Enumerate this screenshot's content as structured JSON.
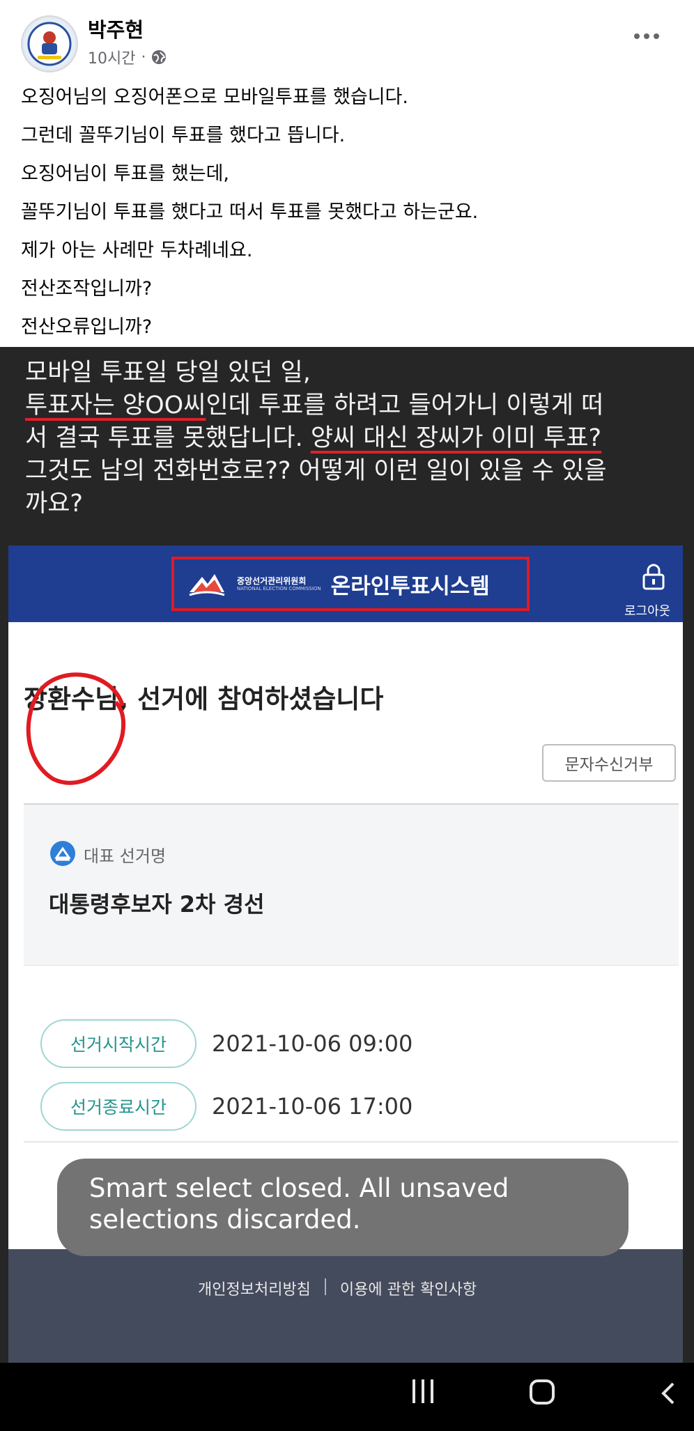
{
  "post": {
    "author": "박주현",
    "time": "10시간",
    "separator": "·",
    "lines": [
      "오징어님의 오징어폰으로 모바일투표를 했습니다.",
      "그런데 꼴뚜기님이 투표를 했다고 뜹니다.",
      "오징어님이 투표를 했는데,",
      "꼴뚜기님이 투표를 했다고 떠서 투표를 못했다고 하는군요.",
      "제가 아는 사례만 두차례네요.",
      "전산조작입니까?",
      "전산오류입니까?"
    ]
  },
  "image": {
    "caption": {
      "line1": "모바일 투표일 당일 있던 일,",
      "line2_underlined": "투표자는 양OO씨",
      "line2_rest": "인데 투표를 하려고 들어가니 이렇게 떠",
      "line3_prefix": "서 결국 투표를 못했답니다. ",
      "line3_underlined": "양씨 대신 장씨가 이미 투표?",
      "line4": "그것도 남의 전화번호로?? 어떻게 이런 일이 있을 수 있을",
      "line5": "까요?"
    },
    "app": {
      "org_name": "중앙선거관리위원회",
      "org_name_en": "NATIONAL ELECTION COMMISSION",
      "system_title": "온라인투표시스템",
      "logout_label": "로그아웃",
      "greeting": "장환수님, 선거에 참여하셨습니다",
      "sms_refuse_button": "문자수신거부",
      "card_label": "대표 선거명",
      "election_name": "대통령후보자 2차 경선",
      "start_label": "선거시작시간",
      "start_time": "2021-10-06 09:00",
      "end_label": "선거종료시간",
      "end_time": "2021-10-06 17:00",
      "toast": "Smart select closed. All unsaved selections discarded.",
      "toast_line1": "Smart select closed. All unsaved",
      "toast_line2": "selections discarded.",
      "footer_privacy": "개인정보처리방침",
      "footer_terms": "이용에 관한 확인사항"
    },
    "colors": {
      "header_blue": "#1f3d91",
      "highlight_red": "#e01b22",
      "teal_accent": "#24948c"
    }
  },
  "navbar": {
    "recent_icon": "recent-apps-icon",
    "home_icon": "home-icon",
    "back_icon": "back-icon"
  }
}
